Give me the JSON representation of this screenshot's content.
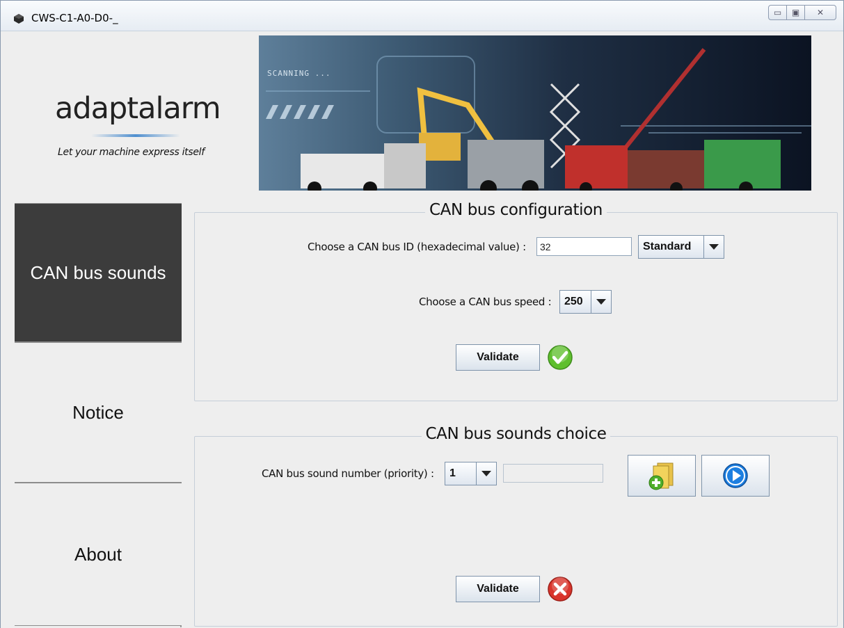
{
  "window": {
    "title": "CWS-C1-A0-D0-_",
    "controls": {
      "minimize": "▭",
      "maximize": "▣",
      "close": "✕"
    }
  },
  "logo": {
    "name": "adaptalarm",
    "tagline": "Let your machine express itself"
  },
  "banner": {
    "overlay_text": "SCANNING ..."
  },
  "nav": {
    "items": [
      {
        "label": "CAN bus sounds",
        "active": true
      },
      {
        "label": "Notice",
        "active": false
      },
      {
        "label": "About",
        "active": false
      }
    ]
  },
  "config": {
    "title": "CAN bus configuration",
    "id_label": "Choose a CAN bus ID (hexadecimal value) :",
    "id_value": "32",
    "frame_type": "Standard",
    "speed_label": "Choose a CAN bus speed :",
    "speed_value": "250",
    "validate_label": "Validate",
    "status": "valid"
  },
  "sounds": {
    "title": "CAN bus sounds choice",
    "number_label": "CAN bus sound number (priority) :",
    "number_value": "1",
    "file_value": "",
    "validate_label": "Validate",
    "status": "invalid"
  },
  "colors": {
    "nav_active_bg": "#3c3c3c",
    "ok_green": "#5fbf2e",
    "error_red": "#d9342b",
    "play_blue": "#1d7fe0"
  }
}
